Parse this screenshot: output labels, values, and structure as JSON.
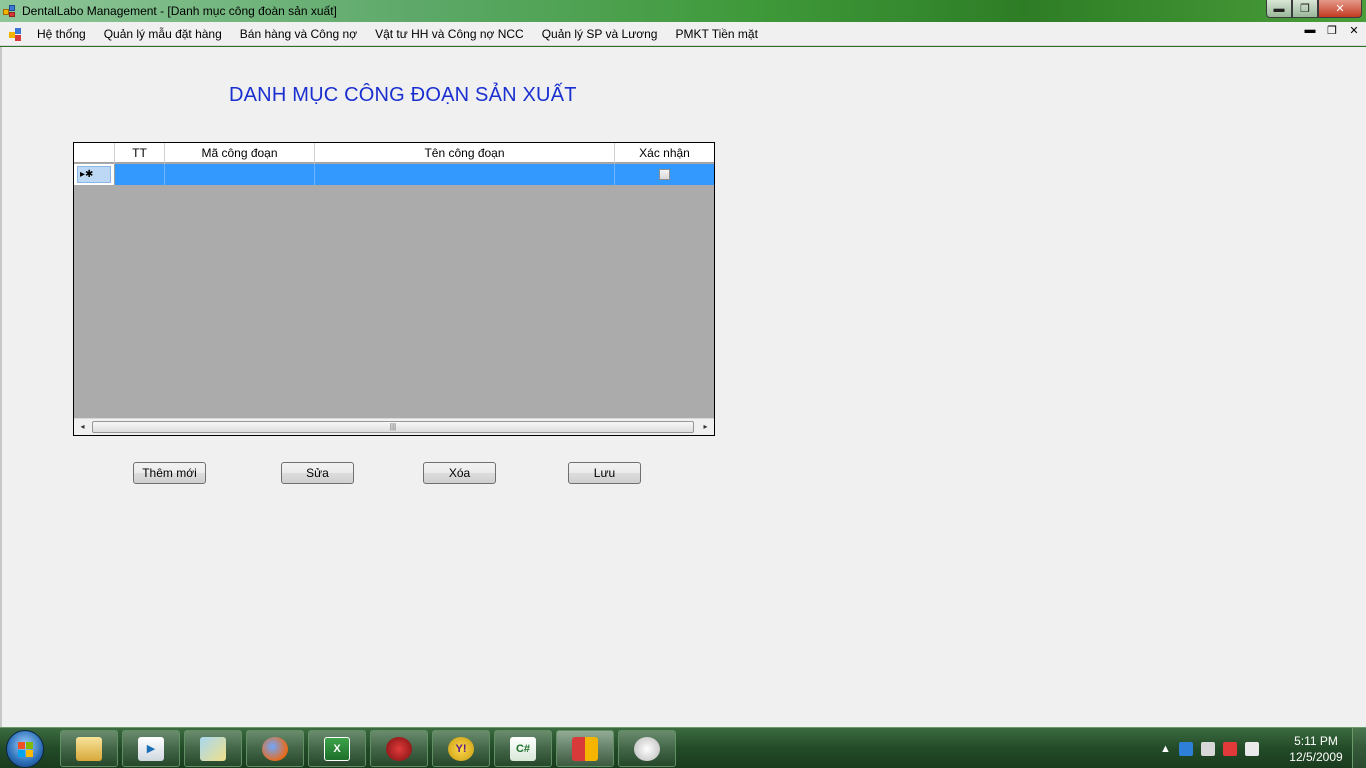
{
  "window": {
    "title": "DentalLabo Management - [Danh mục công đoàn sản xuất]",
    "controls": {
      "minimize": "▬",
      "maximize": "❐",
      "close": "✕"
    }
  },
  "menu": {
    "items": [
      "Hệ thống",
      "Quản lý mẫu đặt hàng",
      "Bán hàng và Công nợ",
      "Vật tư HH và Công nợ NCC",
      "Quản lý SP và Lương",
      "PMKT Tiền mặt"
    ],
    "mdi": {
      "minimize": "▬",
      "restore": "❐",
      "close": "✕"
    }
  },
  "form": {
    "title": "DANH MỤC CÔNG ĐOẠN SẢN XUẤT"
  },
  "grid": {
    "columns": [
      "TT",
      "Mã công đoạn",
      "Tên công đoạn",
      "Xác nhận"
    ],
    "new_row_marker": "▸✱",
    "scroll": {
      "left": "◂",
      "right": "▸",
      "grip": "|||"
    }
  },
  "buttons": {
    "add": "Thêm mới",
    "edit": "Sửa",
    "delete": "Xóa",
    "save": "Lưu"
  },
  "taskbar": {
    "apps": [
      {
        "name": "explorer",
        "label": ""
      },
      {
        "name": "media-player",
        "label": "▶"
      },
      {
        "name": "folder",
        "label": ""
      },
      {
        "name": "firefox",
        "label": ""
      },
      {
        "name": "excel",
        "label": "X"
      },
      {
        "name": "app-red",
        "label": ""
      },
      {
        "name": "yahoo-messenger",
        "label": "Y!"
      },
      {
        "name": "csharp",
        "label": "C#"
      },
      {
        "name": "dentallabo",
        "label": ""
      },
      {
        "name": "paint",
        "label": ""
      }
    ],
    "clock": {
      "time": "5:11 PM",
      "date": "12/5/2009"
    },
    "tray_arrow": "▲"
  },
  "colors": {
    "form_title": "#1a2fd0",
    "selection": "#3399ff",
    "grid_background": "#ababab"
  }
}
